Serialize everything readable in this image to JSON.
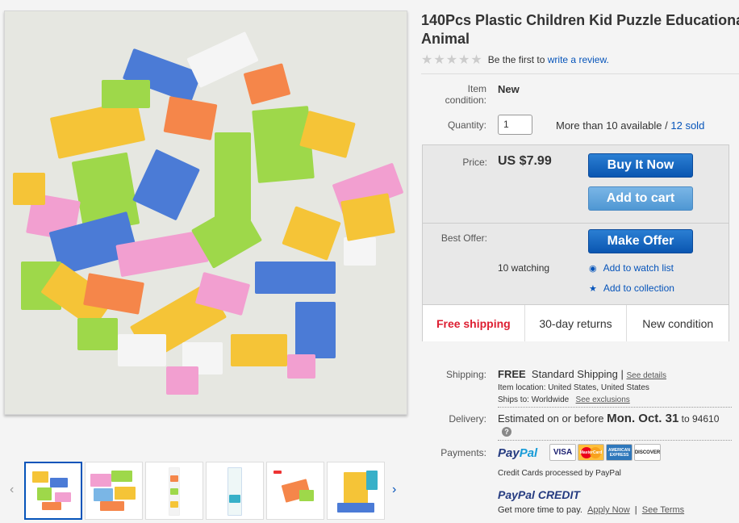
{
  "product": {
    "title": "140Pcs Plastic Children Kid Puzzle Educationa",
    "title_line2": "Animal",
    "rating_prefix": "Be the first to ",
    "rating_link": "write a review."
  },
  "condition": {
    "label": "Item condition:",
    "value": "New"
  },
  "quantity": {
    "label": "Quantity:",
    "value": "1",
    "available": "More than 10 available / ",
    "sold": "12 sold"
  },
  "price": {
    "label": "Price:",
    "value": "US $7.99",
    "buy_now": "Buy It Now",
    "add_to_cart": "Add to cart"
  },
  "offer": {
    "label": "Best Offer:",
    "make_offer": "Make Offer",
    "watching": "10 watching",
    "add_watch": "Add to watch list",
    "add_collection": "Add to collection"
  },
  "features": [
    "Free shipping",
    "30-day returns",
    "New condition"
  ],
  "shipping": {
    "label": "Shipping:",
    "free": "FREE",
    "method": "Standard Shipping |",
    "details_link": "See details",
    "item_location": "Item location:  United States, United States",
    "ships_to": "Ships to:  Worldwide",
    "exclusions_link": "See exclusions"
  },
  "delivery": {
    "label": "Delivery:",
    "prefix": "Estimated on or before ",
    "date": "Mon. Oct. 31",
    "suffix": " to 94610",
    "help_icon": "?"
  },
  "payments": {
    "label": "Payments:",
    "paypal_1": "Pay",
    "paypal_2": "Pal",
    "cards": [
      "VISA",
      "MasterCard",
      "AMERICAN EXPRESS",
      "DISCOVER"
    ],
    "cards_note": "Credit Cards processed by PayPal",
    "credit_1": "PayPal",
    "credit_2": " CREDIT",
    "credit_text": "Get more time to pay.",
    "apply_link": "Apply Now",
    "sep": "|",
    "terms_link": "See Terms"
  },
  "colors": {
    "link": "#0654ba",
    "buy_button": "#0a56b1",
    "cart_button": "#4f97d3",
    "free_shipping": "#dd1e31"
  },
  "icons": [
    "star-icon",
    "eye-icon",
    "star-collection-icon",
    "chevron-left-icon",
    "chevron-right-icon"
  ]
}
